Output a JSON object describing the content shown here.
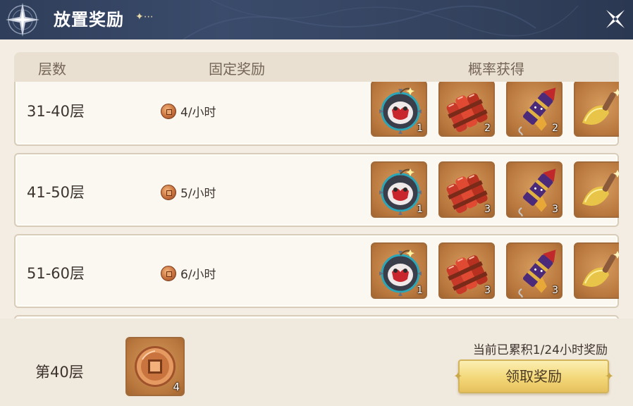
{
  "header": {
    "title": "放置奖励",
    "sparkle": "✦⋯",
    "close_icon": "close-x-icon"
  },
  "table": {
    "col_floor": "层数",
    "col_fixed": "固定奖励",
    "col_chance": "概率获得"
  },
  "rows": [
    {
      "floor": "31-40层",
      "fixed_reward": "4/小时",
      "items": [
        {
          "icon": "bomb-icon",
          "count": "1"
        },
        {
          "icon": "dynamite-icon",
          "count": "2"
        },
        {
          "icon": "firework-rocket-icon",
          "count": "2"
        },
        {
          "icon": "golden-shovel-icon",
          "count": ""
        }
      ]
    },
    {
      "floor": "41-50层",
      "fixed_reward": "5/小时",
      "items": [
        {
          "icon": "bomb-icon",
          "count": "1"
        },
        {
          "icon": "dynamite-icon",
          "count": "3"
        },
        {
          "icon": "firework-rocket-icon",
          "count": "3"
        },
        {
          "icon": "golden-shovel-icon",
          "count": ""
        }
      ]
    },
    {
      "floor": "51-60层",
      "fixed_reward": "6/小时",
      "items": [
        {
          "icon": "bomb-icon",
          "count": "1"
        },
        {
          "icon": "dynamite-icon",
          "count": "3"
        },
        {
          "icon": "firework-rocket-icon",
          "count": "3"
        },
        {
          "icon": "golden-shovel-icon",
          "count": ""
        }
      ]
    }
  ],
  "footer": {
    "current_floor": "第40层",
    "coin_count": "4",
    "accumulated": "当前已累积1/24小时奖励",
    "claim_label": "领取奖励"
  }
}
